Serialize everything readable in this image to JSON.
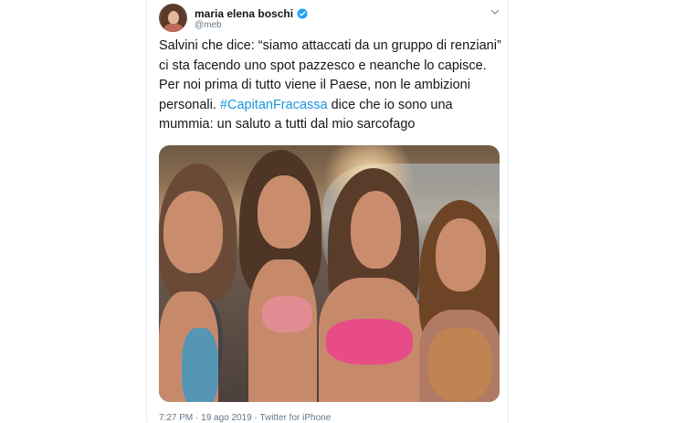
{
  "tweet": {
    "author_name": "maria elena boschi",
    "author_handle": "@meb",
    "text_before": "Salvini che dice: “siamo attaccati da un gruppo di renziani” ci sta facendo uno spot pazzesco e neanche lo capisce. Per noi prima di tutto viene il Paese, non le ambizioni personali. ",
    "hashtag": "#CapitanFracassa",
    "text_after": " dice che io sono una mummia: un saluto a tutti dal mio sarcofago",
    "footer_partial": "7:27 PM · 19 ago 2019 · Twitter for iPhone"
  },
  "colors": {
    "link": "#1b95e0",
    "verified": "#1da1f2",
    "text": "#14171a",
    "secondary": "#657786"
  },
  "icons": [
    "verified-badge-icon",
    "chevron-down-icon"
  ]
}
